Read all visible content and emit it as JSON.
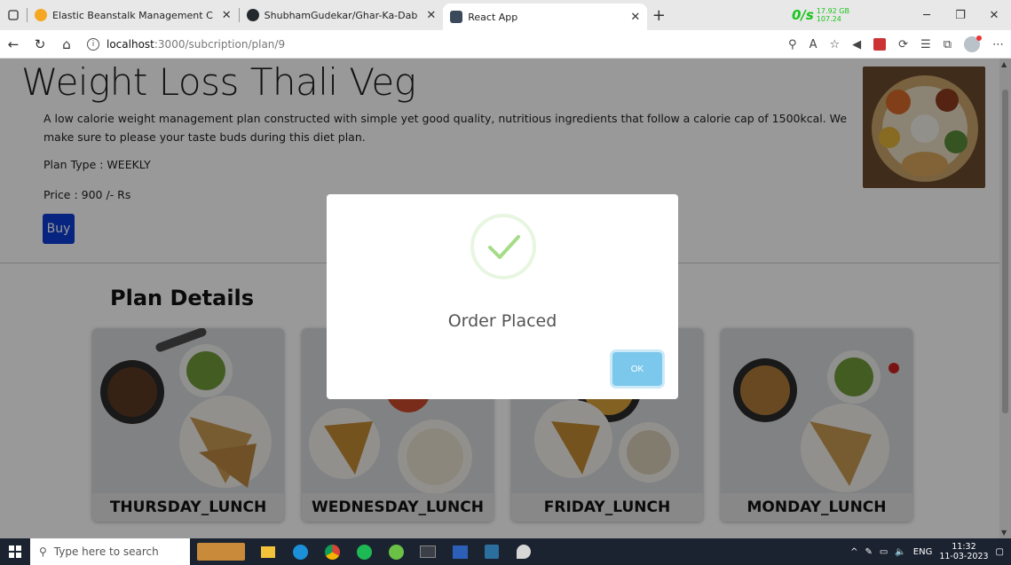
{
  "browser": {
    "tabs": [
      {
        "title": "Elastic Beanstalk Management C",
        "icon_color": "#f5a623"
      },
      {
        "title": "ShubhamGudekar/Ghar-Ka-Dab",
        "icon_color": "#24292e"
      },
      {
        "title": "React App",
        "icon_color": "#3b4a5a"
      }
    ],
    "net_speed": "0/s",
    "net_line1": "17.92 GB",
    "net_line2": "107.24",
    "url_host": "localhost",
    "url_path": ":3000/subcription/plan/9"
  },
  "plan": {
    "title": "Weight Loss Thali Veg",
    "description": "A low calorie weight management plan constructed with simple yet good quality, nutritious ingredients that follow a calorie cap of 1500kcal. We make sure to please your taste buds during this diet plan.",
    "type_line": "Plan Type : WEEKLY",
    "price_line": "Price : 900 /- Rs",
    "buy_label": "Buy"
  },
  "details": {
    "heading": "Plan Details",
    "cards": [
      {
        "label": "THURSDAY_LUNCH"
      },
      {
        "label": "WEDNESDAY_LUNCH"
      },
      {
        "label": "FRIDAY_LUNCH"
      },
      {
        "label": "MONDAY_LUNCH"
      }
    ]
  },
  "modal": {
    "title": "Order Placed",
    "ok_label": "OK",
    "accent": "#a5dc86"
  },
  "taskbar": {
    "search_placeholder": "Type here to search",
    "lang": "ENG",
    "time": "11:32",
    "date": "11-03-2023"
  },
  "colors": {
    "buy_button": "#0d3fd6",
    "ok_button": "#7cc8ec"
  }
}
